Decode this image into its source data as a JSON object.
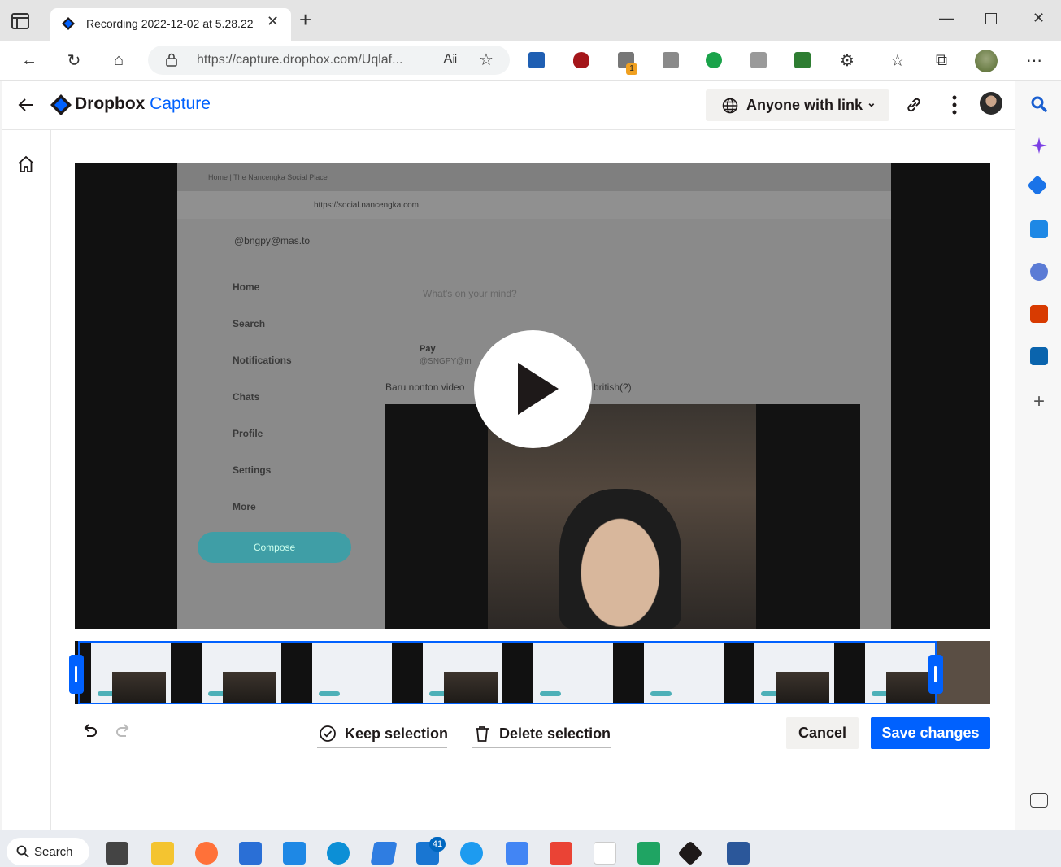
{
  "browser": {
    "tab_title": "Recording 2022-12-02 at 5.28.22",
    "url": "https://capture.dropbox.com/Uqlaf...",
    "extension_badge": "1"
  },
  "header": {
    "brand": "Dropbox",
    "brand_suffix": "Capture",
    "share_label": "Anyone with link"
  },
  "video": {
    "inner_tab": "Home | The Nancengka Social Place",
    "inner_url": "https://social.nancengka.com",
    "inner_handle": "@bngpy@mas.to",
    "inner_nav": [
      "Home",
      "Search",
      "Notifications",
      "Chats",
      "Profile",
      "Settings",
      "More"
    ],
    "inner_compose": "Compose",
    "inner_prompt": "What's on your mind?",
    "inner_author": "Pay",
    "inner_author_handle": "@SNGPY@m",
    "inner_post": "Baru nonton video",
    "inner_post_tail": "british(?)"
  },
  "editor": {
    "keep_label": "Keep selection",
    "delete_label": "Delete selection",
    "cancel_label": "Cancel",
    "save_label": "Save changes"
  },
  "taskbar": {
    "search_label": "Search",
    "mail_badge": "41"
  },
  "colors": {
    "accent": "#0061fe",
    "secondary_button": "#f2f1ef",
    "text": "#1e1919"
  }
}
